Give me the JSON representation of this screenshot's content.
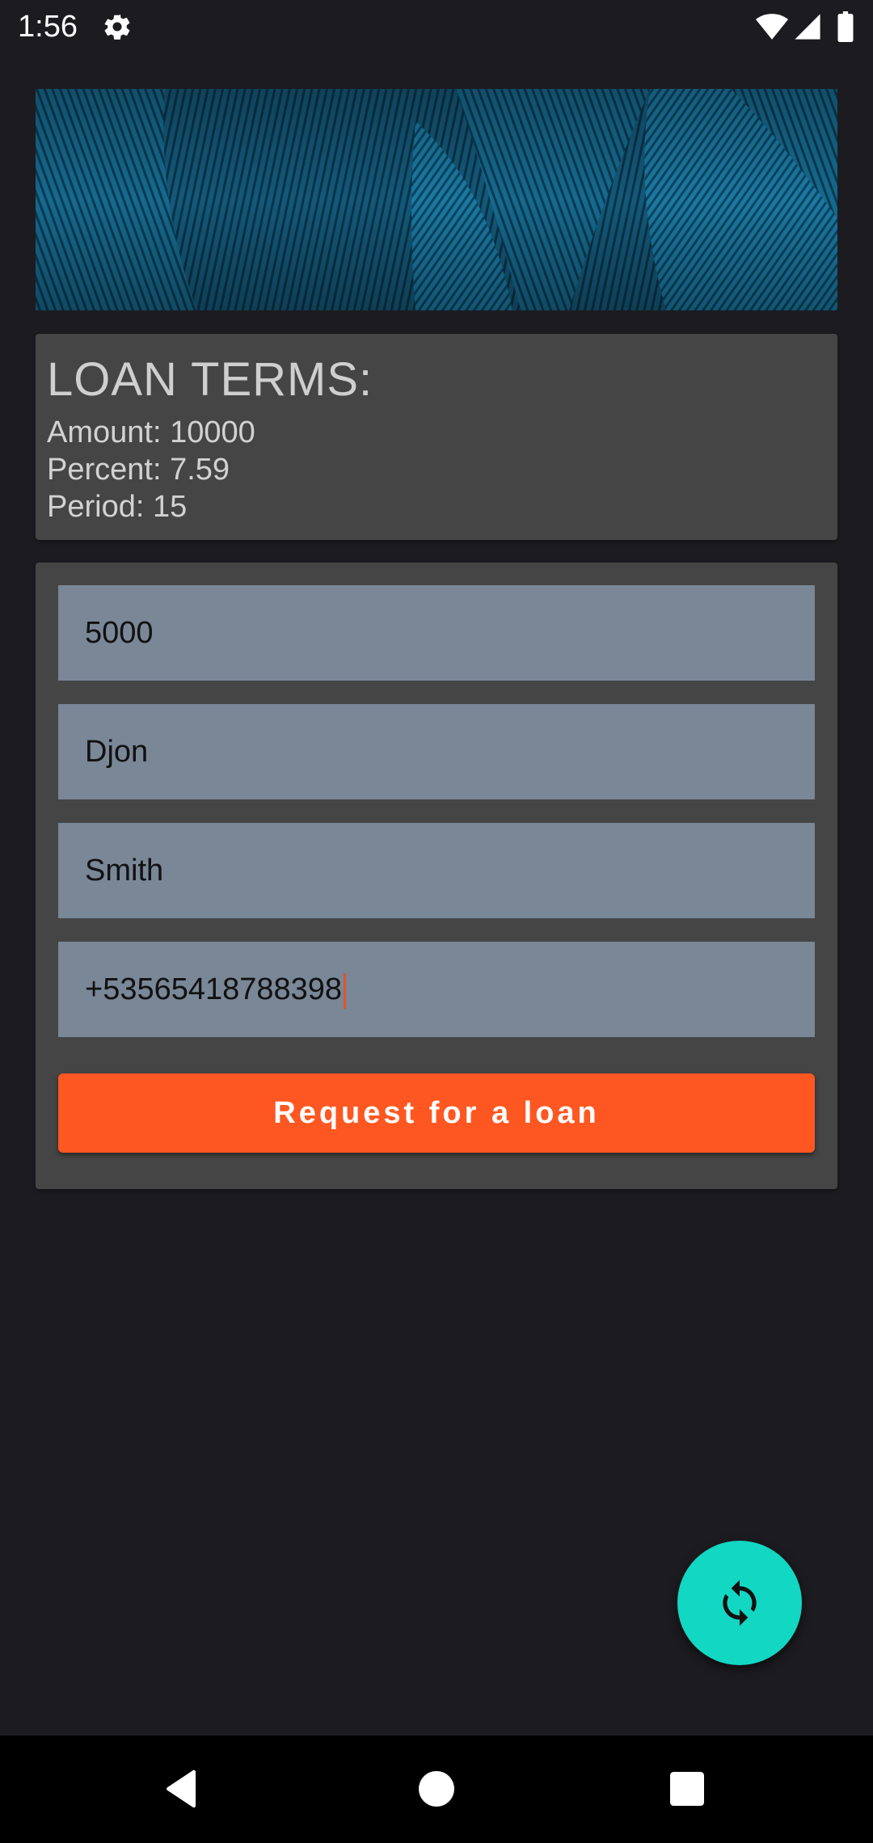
{
  "status_bar": {
    "time": "1:56",
    "icons": [
      "gear-icon",
      "wifi-icon",
      "signal-icon",
      "battery-icon"
    ]
  },
  "banner": {
    "description_icon": "feather-texture-image",
    "color": "#0f4a66"
  },
  "loan_terms": {
    "title": "LOAN TERMS:",
    "amount_line": "Amount: 10000",
    "percent_line": "Percent: 7.59",
    "period_line": "Period: 15"
  },
  "form": {
    "amount_value": "5000",
    "first_name_value": "Djon",
    "last_name_value": "Smith",
    "phone_value": "+53565418788398",
    "submit_label": "Request for a loan"
  },
  "fab": {
    "icon": "refresh-icon",
    "color": "#12d7c2"
  },
  "nav_bar": {
    "icons": [
      "back-icon",
      "home-icon",
      "recents-icon"
    ]
  },
  "colors": {
    "accent": "#ff5722",
    "card": "#454545",
    "field": "#798797",
    "background": "#1c1b20"
  }
}
